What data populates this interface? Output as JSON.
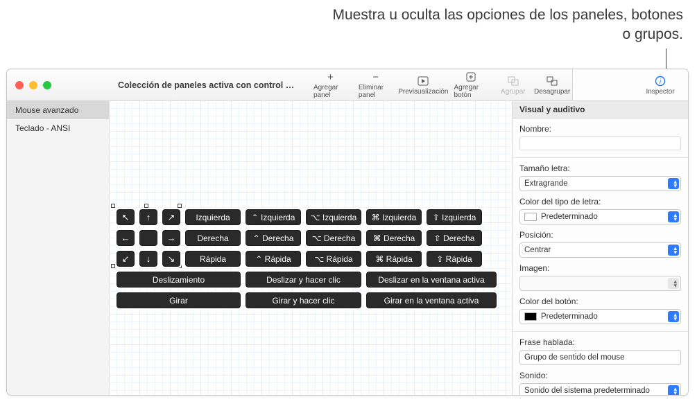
{
  "callout": "Muestra u oculta las opciones de los paneles, botones o grupos.",
  "window_title": "Colección de paneles activa con control …",
  "toolbar": {
    "add_panel": "Agregar panel",
    "remove_panel": "Eliminar panel",
    "preview": "Previsualización",
    "add_button": "Agregar botón",
    "group": "Agrupar",
    "ungroup": "Desagrupar",
    "inspector": "Inspector"
  },
  "sidebar": {
    "items": [
      "Mouse avanzado",
      "Teclado - ANSI"
    ]
  },
  "panel_buttons": {
    "row0": {
      "arrows": [
        "↖",
        "↑",
        "↗"
      ],
      "label": "Izquierda",
      "mods": [
        "⌃ Izquierda",
        "⌥ Izquierda",
        "⌘ Izquierda",
        "⇧ Izquierda"
      ]
    },
    "row1": {
      "arrows": [
        "←",
        "",
        "→"
      ],
      "label": "Derecha",
      "mods": [
        "⌃ Derecha",
        "⌥ Derecha",
        "⌘ Derecha",
        "⇧ Derecha"
      ]
    },
    "row2": {
      "arrows": [
        "↙",
        "↓",
        "↘"
      ],
      "label": "Rápida",
      "mods": [
        "⌃ Rápida",
        "⌥ Rápida",
        "⌘ Rápida",
        "⇧ Rápida"
      ]
    },
    "row3": [
      "Deslizamiento",
      "Deslizar y hacer clic",
      "Deslizar en la ventana activa"
    ],
    "row4": [
      "Girar",
      "Girar y hacer clic",
      "Girar en la ventana activa"
    ]
  },
  "inspector": {
    "header": "Visual y auditivo",
    "name_label": "Nombre:",
    "font_size_label": "Tamaño letra:",
    "font_size_value": "Extragrande",
    "font_color_label": "Color del tipo de letra:",
    "font_color_value": "Predeterminado",
    "position_label": "Posición:",
    "position_value": "Centrar",
    "image_label": "Imagen:",
    "image_value": "",
    "button_color_label": "Color del botón:",
    "button_color_value": "Predeterminado",
    "spoken_label": "Frase hablada:",
    "spoken_value": "Grupo de sentido del mouse",
    "sound_label": "Sonido:",
    "sound_value": "Sonido del sistema predeterminado"
  }
}
